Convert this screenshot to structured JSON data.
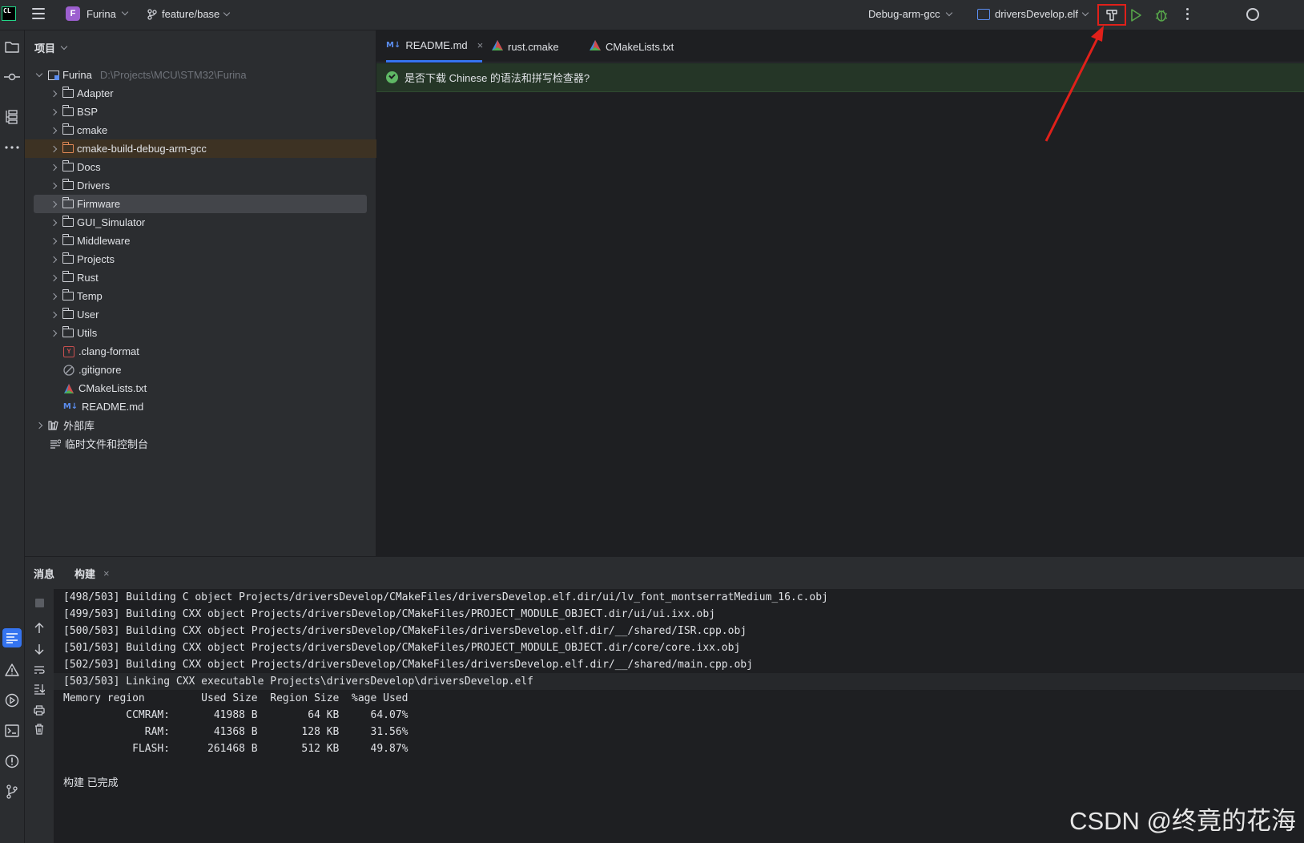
{
  "titlebar": {
    "app_logo": "CL",
    "project_badge": "F",
    "project_name": "Furina",
    "branch": "feature/base",
    "config": "Debug-arm-gcc",
    "target": "driversDevelop.elf"
  },
  "project_panel": {
    "title": "项目",
    "root": {
      "name": "Furina",
      "path": "D:\\Projects\\MCU\\STM32\\Furina"
    },
    "folders": [
      "Adapter",
      "BSP",
      "cmake",
      "cmake-build-debug-arm-gcc",
      "Docs",
      "Drivers",
      "Firmware",
      "GUI_Simulator",
      "Middleware",
      "Projects",
      "Rust",
      "Temp",
      "User",
      "Utils"
    ],
    "files": [
      {
        "name": ".clang-format",
        "icon": "yaml-icon"
      },
      {
        "name": ".gitignore",
        "icon": "ignore-icon"
      },
      {
        "name": "CMakeLists.txt",
        "icon": "cmake-icon"
      },
      {
        "name": "README.md",
        "icon": "markdown-icon"
      }
    ],
    "external_libs": "外部库",
    "scratches": "临时文件和控制台"
  },
  "editor": {
    "tabs": [
      {
        "label": "README.md",
        "active": true
      },
      {
        "label": "rust.cmake",
        "active": false
      },
      {
        "label": "CMakeLists.txt",
        "active": false
      }
    ],
    "md_badge": "M↓",
    "notification": "是否下载 Chinese 的语法和拼写检查器?"
  },
  "bottom_panel": {
    "tabs": [
      "消息",
      "构建"
    ],
    "close_glyph": "×",
    "lines": [
      "[498/503] Building C object Projects/driversDevelop/CMakeFiles/driversDevelop.elf.dir/ui/lv_font_montserratMedium_16.c.obj",
      "[499/503] Building CXX object Projects/driversDevelop/CMakeFiles/PROJECT_MODULE_OBJECT.dir/ui/ui.ixx.obj",
      "[500/503] Building CXX object Projects/driversDevelop/CMakeFiles/driversDevelop.elf.dir/__/shared/ISR.cpp.obj",
      "[501/503] Building CXX object Projects/driversDevelop/CMakeFiles/PROJECT_MODULE_OBJECT.dir/core/core.ixx.obj",
      "[502/503] Building CXX object Projects/driversDevelop/CMakeFiles/driversDevelop.elf.dir/__/shared/main.cpp.obj",
      "[503/503] Linking CXX executable Projects\\driversDevelop\\driversDevelop.elf",
      "Memory region         Used Size  Region Size  %age Used",
      "          CCMRAM:       41988 B        64 KB     64.07%",
      "             RAM:       41368 B       128 KB     31.56%",
      "           FLASH:      261468 B       512 KB     49.87%"
    ],
    "status": "构建 已完成"
  },
  "watermark": "CSDN @终竟的花海",
  "colors": {
    "accent": "#3574f0",
    "annotation": "#e0201a",
    "notification_bg": "#253627"
  }
}
